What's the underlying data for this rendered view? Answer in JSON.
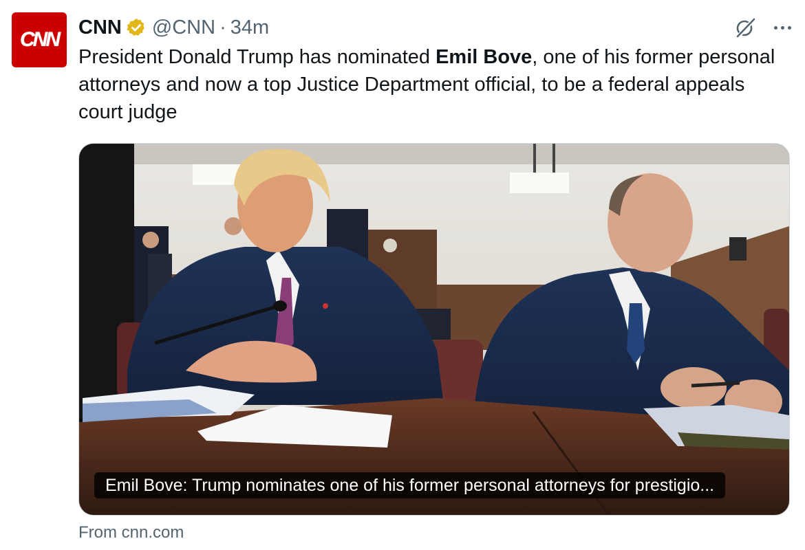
{
  "author": {
    "avatar_text": "CNN",
    "name": "CNN",
    "verified_icon": "gold-verified-badge-icon",
    "handle": "@CNN",
    "separator": "·",
    "time": "34m"
  },
  "actions": {
    "grok_icon": "grok-icon",
    "more_icon": "more-options-icon"
  },
  "tweet": {
    "text_before": "President Donald Trump has nominated ",
    "text_bold": "Emil Bove",
    "text_after": ", one of his former personal attorneys and now a top Justice Department official, to be a federal appeals court judge"
  },
  "card": {
    "caption": "Emil Bove: Trump nominates one of his former personal attorneys for prestigio...",
    "source": "From cnn.com"
  },
  "colors": {
    "brand_red": "#cc0000",
    "verified_gold": "#e2b719",
    "muted_text": "#536471",
    "primary_text": "#0f1419"
  }
}
